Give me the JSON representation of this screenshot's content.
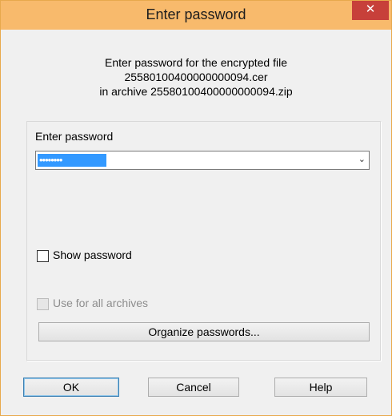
{
  "window": {
    "title": "Enter password",
    "close_label": "✕"
  },
  "info": {
    "line1": "Enter password for the encrypted file",
    "line2": "25580100400000000094.cer",
    "line3": "in archive 25580100400000000094.zip"
  },
  "password": {
    "label": "Enter password",
    "value_masked": "••••••••",
    "dropdown_icon": "chevron-down-icon"
  },
  "options": {
    "show_password_label": "Show password",
    "show_password_checked": false,
    "use_for_all_label": "Use for all archives",
    "use_for_all_checked": false,
    "use_for_all_enabled": false
  },
  "buttons": {
    "organize": "Organize passwords...",
    "ok": "OK",
    "cancel": "Cancel",
    "help": "Help"
  },
  "colors": {
    "titlebar": "#f8ba6c",
    "close": "#c7403a",
    "selection": "#3399ff"
  }
}
